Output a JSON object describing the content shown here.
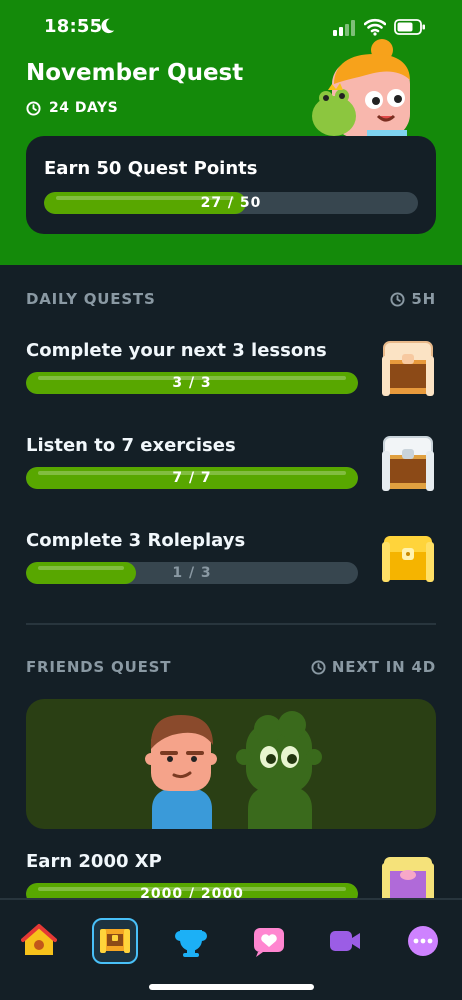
{
  "status": {
    "time": "18:55"
  },
  "header": {
    "title": "November Quest",
    "days": "24 DAYS",
    "monthly": {
      "label": "Earn 50 Quest Points",
      "progress_text": "27 / 50",
      "progress": 0.54
    }
  },
  "daily": {
    "heading": "DAILY QUESTS",
    "timer": "5H",
    "quests": [
      {
        "name": "Complete your next 3 lessons",
        "progress_text": "3 / 3",
        "progress": 1.0,
        "chest": "bronze-chest-icon"
      },
      {
        "name": "Listen to 7 exercises",
        "progress_text": "7 / 7",
        "progress": 1.0,
        "chest": "silver-chest-icon"
      },
      {
        "name": "Complete 3 Roleplays",
        "progress_text": "1 / 3",
        "progress": 0.33,
        "chest": "gold-chest-icon"
      }
    ]
  },
  "friends": {
    "heading": "FRIENDS QUEST",
    "next": "NEXT IN 4D",
    "quest": {
      "name": "Earn 2000 XP",
      "progress_text": "2000 / 2000",
      "progress": 1.0,
      "chest": "purple-chest-icon"
    }
  },
  "tabs": [
    "home-icon",
    "quests-icon",
    "leagues-icon",
    "health-icon",
    "video-icon",
    "more-icon"
  ],
  "colors": {
    "hero_green": "#148a0a",
    "bar_fill": "#58a700",
    "bar_track": "#37464f",
    "active_tab": "#49c0f8"
  }
}
